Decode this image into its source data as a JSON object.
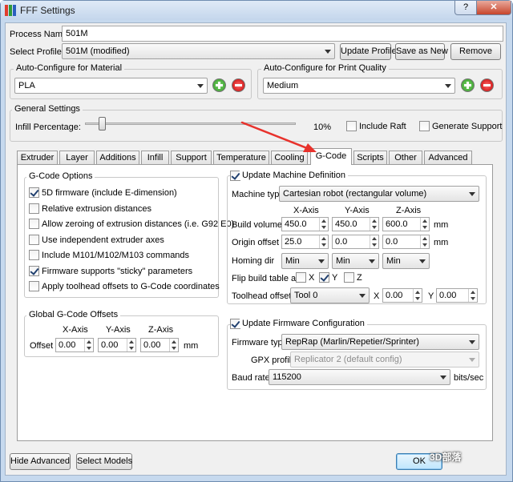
{
  "window": {
    "title": "FFF Settings",
    "help_label": "?",
    "close_label": "✕"
  },
  "process": {
    "label": "Process Name:",
    "value": "501M"
  },
  "profile": {
    "label": "Select Profile:",
    "value": "501M (modified)",
    "update_label": "Update Profile",
    "save_as_label": "Save as New",
    "remove_label": "Remove"
  },
  "material": {
    "label": "Auto-Configure for Material",
    "value": "PLA"
  },
  "quality": {
    "label": "Auto-Configure for Print Quality",
    "value": "Medium"
  },
  "general": {
    "label": "General Settings",
    "infill_label": "Infill Percentage:",
    "infill_value": "10%",
    "infill_fraction": 0.1,
    "raft_label": "Include Raft",
    "support_label": "Generate Support"
  },
  "tabs": [
    "Extruder",
    "Layer",
    "Additions",
    "Infill",
    "Support",
    "Temperature",
    "Cooling",
    "G-Code",
    "Scripts",
    "Other",
    "Advanced"
  ],
  "active_tab": "G-Code",
  "gcode_options": {
    "title": "G-Code Options",
    "items": [
      {
        "label": "5D firmware (include E-dimension)",
        "checked": true
      },
      {
        "label": "Relative extrusion distances",
        "checked": false
      },
      {
        "label": "Allow zeroing of extrusion distances (i.e. G92 E0)",
        "checked": false
      },
      {
        "label": "Use independent extruder axes",
        "checked": false
      },
      {
        "label": "Include M101/M102/M103 commands",
        "checked": false
      },
      {
        "label": "Firmware supports \"sticky\" parameters",
        "checked": true
      },
      {
        "label": "Apply toolhead offsets to G-Code coordinates",
        "checked": false
      }
    ]
  },
  "global_offsets": {
    "title": "Global G-Code Offsets",
    "x_label": "X-Axis",
    "y_label": "Y-Axis",
    "z_label": "Z-Axis",
    "row_label": "Offset",
    "x": "0.00",
    "y": "0.00",
    "z": "0.00",
    "unit": "mm"
  },
  "machine": {
    "title": "Update Machine Definition",
    "checked": true,
    "type_label": "Machine type",
    "type_value": "Cartesian robot (rectangular volume)",
    "x_label": "X-Axis",
    "y_label": "Y-Axis",
    "z_label": "Z-Axis",
    "build_label": "Build volume",
    "build": [
      "450.0",
      "450.0",
      "600.0"
    ],
    "origin_label": "Origin offset",
    "origin": [
      "25.0",
      "0.0",
      "0.0"
    ],
    "unit": "mm",
    "homing_label": "Homing dir",
    "homing": [
      "Min",
      "Min",
      "Min"
    ],
    "flip_label": "Flip build table axis",
    "flip": [
      {
        "label": "X",
        "checked": false
      },
      {
        "label": "Y",
        "checked": true
      },
      {
        "label": "Z",
        "checked": false
      }
    ],
    "toolhead_label": "Toolhead offsets",
    "toolhead_value": "Tool 0",
    "th_x_label": "X",
    "th_x": "0.00",
    "th_y_label": "Y",
    "th_y": "0.00"
  },
  "firmware": {
    "title": "Update Firmware Configuration",
    "checked": true,
    "type_label": "Firmware type",
    "type_value": "RepRap (Marlin/Repetier/Sprinter)",
    "gpx_label": "GPX profile",
    "gpx_value": "Replicator 2 (default config)",
    "baud_label": "Baud rate",
    "baud_value": "115200",
    "baud_unit": "bits/sec"
  },
  "footer": {
    "hide_label": "Hide Advanced",
    "select_models_label": "Select Models",
    "ok_label": "OK"
  },
  "watermark": "3D部落",
  "colors": {
    "annotation_arrow": "#e8322c",
    "titlebar": "#c4d6ec"
  }
}
